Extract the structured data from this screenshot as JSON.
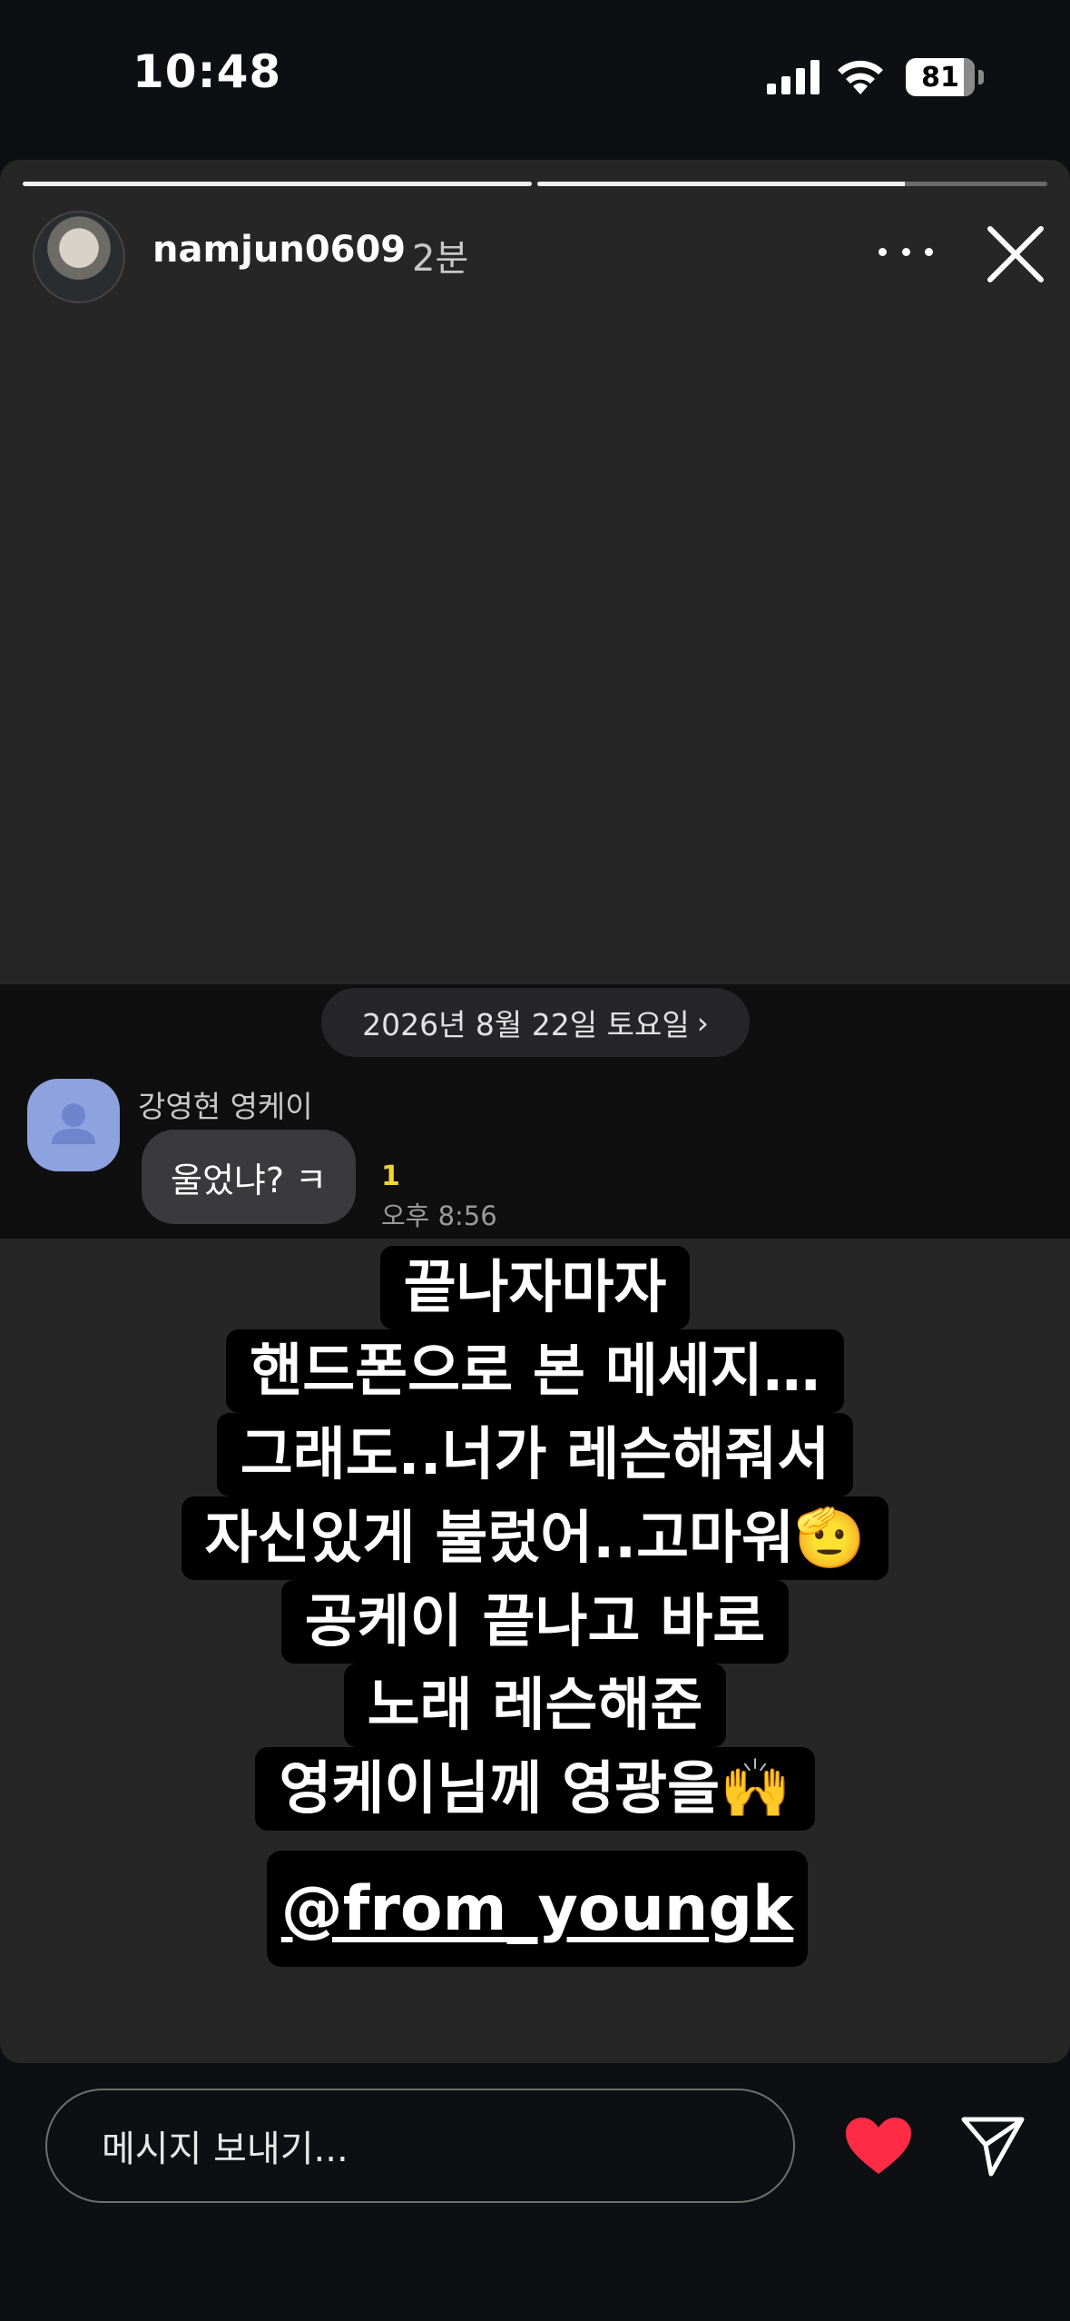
{
  "status_bar": {
    "time": "10:48",
    "battery": "81"
  },
  "story": {
    "username": "namjun0609",
    "time_ago": "2분",
    "progress": [
      1.0,
      0.72
    ]
  },
  "chat_screenshot": {
    "date": "2026년 8월 22일 토요일",
    "sender": "강영현 영케이",
    "message": "울었냐? ㅋ",
    "unread_count": "1",
    "message_time": "오후 8:56"
  },
  "caption": {
    "lines": [
      "끝나자마자",
      "핸드폰으로 본 메세지…",
      "그래도..너가 레슨해줘서",
      "자신있게 불렀어..고마워🫡",
      "공케이 끝나고 바로",
      "노래 레슨해준",
      "영케이님께 영광을🙌"
    ],
    "mention": "@from_youngk"
  },
  "reply_bar": {
    "placeholder": "메시지 보내기..."
  },
  "colors": {
    "heart": "#ff2b45",
    "chat_avatar": "#8ea2e0",
    "unread": "#f2d330"
  }
}
